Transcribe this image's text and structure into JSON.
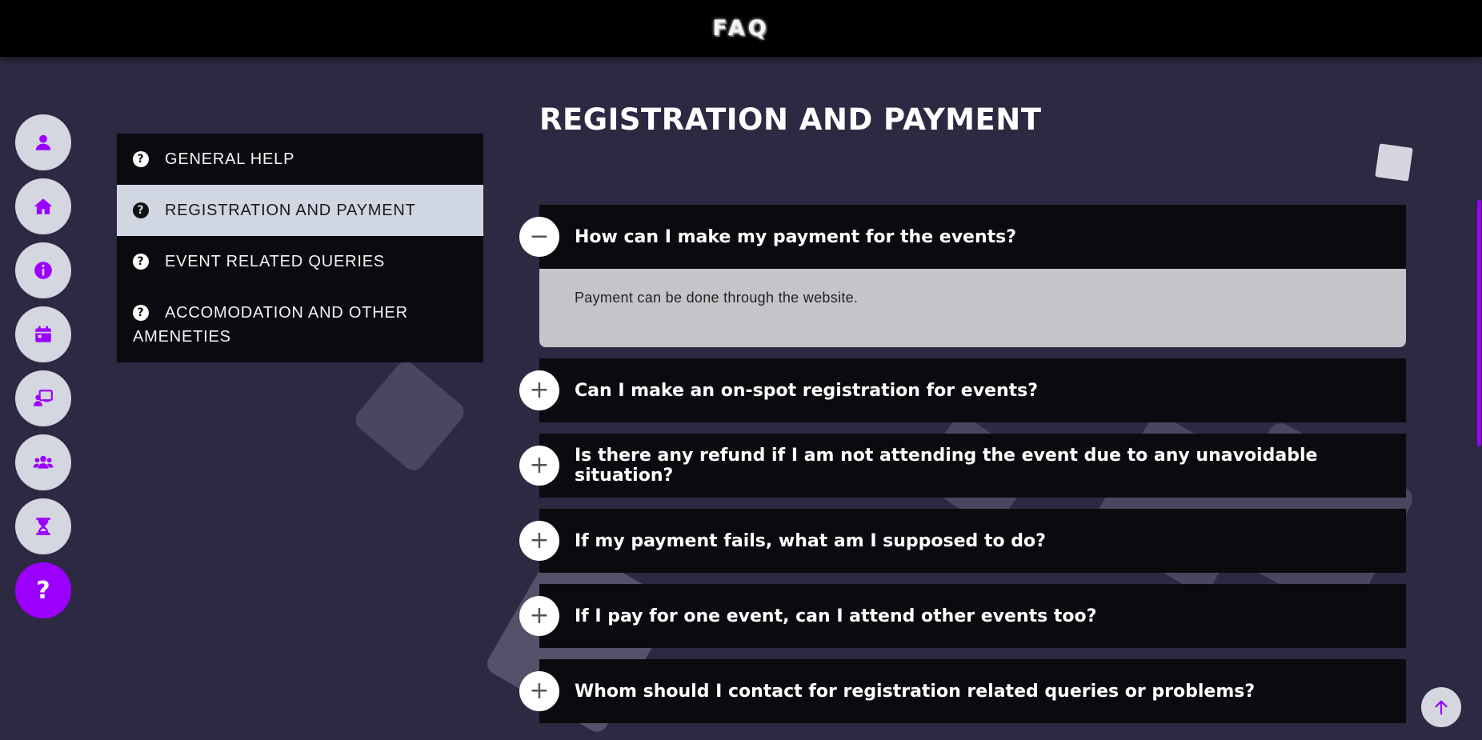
{
  "header": {
    "title": "FAQ"
  },
  "sidebar": {
    "items": [
      {
        "icon": "user-icon",
        "active": false
      },
      {
        "icon": "home-icon",
        "active": false
      },
      {
        "icon": "info-icon",
        "active": false
      },
      {
        "icon": "calendar-icon",
        "active": false
      },
      {
        "icon": "presentation-icon",
        "active": false
      },
      {
        "icon": "team-icon",
        "active": false
      },
      {
        "icon": "hourglass-icon",
        "active": false
      },
      {
        "icon": "question-icon",
        "active": true,
        "glyph": "?"
      }
    ]
  },
  "categories": {
    "icon_glyph": "?",
    "items": [
      {
        "label": "GENERAL HELP",
        "active": false
      },
      {
        "label": "REGISTRATION AND PAYMENT",
        "active": true
      },
      {
        "label": "EVENT RELATED QUERIES",
        "active": false
      },
      {
        "label": "ACCOMODATION AND OTHER AMENETIES",
        "active": false
      }
    ]
  },
  "section": {
    "title": "REGISTRATION AND PAYMENT"
  },
  "faq": {
    "expanded_symbol": "−",
    "collapsed_symbol": "+",
    "items": [
      {
        "question": "How can I make my payment for the events?",
        "answer": "Payment can be done through the website.",
        "expanded": true
      },
      {
        "question": "Can I make an on-spot registration for events?",
        "expanded": false
      },
      {
        "question": "Is there any refund if I am not attending the event due to any unavoidable situation?",
        "expanded": false
      },
      {
        "question": "If my payment fails, what am I supposed to do?",
        "expanded": false
      },
      {
        "question": "If I pay for one event, can I attend other events too?",
        "expanded": false
      },
      {
        "question": "Whom should I contact for registration related queries or problems?",
        "expanded": false
      }
    ]
  },
  "colors": {
    "accent": "#9b00ff",
    "background": "#2e2942",
    "panel": "#0b0b0f",
    "active_item": "#d0d6e2",
    "answer_bg": "#c4c5c8"
  },
  "scroll_to_top": {
    "icon": "arrow-up-icon"
  }
}
